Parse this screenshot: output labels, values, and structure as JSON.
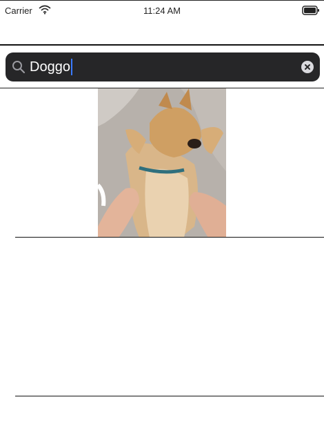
{
  "status_bar": {
    "carrier": "Carrier",
    "time": "11:24 AM",
    "wifi_icon": "wifi-icon",
    "battery_icon": "battery-icon"
  },
  "search": {
    "value": "Doggo",
    "search_icon": "search-icon",
    "clear_icon": "clear-circle-icon",
    "field_color": "#262628"
  },
  "results": [
    {
      "image": "dog-photo",
      "description": "image result"
    }
  ]
}
